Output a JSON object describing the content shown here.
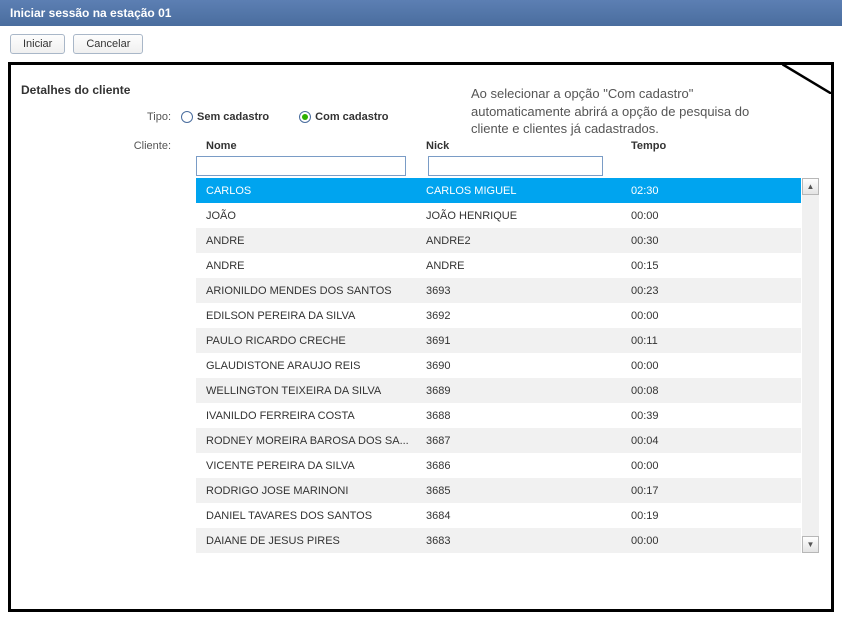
{
  "window": {
    "title": "Iniciar sessão na estação 01"
  },
  "toolbar": {
    "iniciar": "Iniciar",
    "cancelar": "Cancelar"
  },
  "section": {
    "title": "Detalhes do cliente"
  },
  "annotation": "Ao selecionar a opção \"Com cadastro\" automaticamente abrirá a opção de pesquisa do cliente e clientes já cadastrados.",
  "form": {
    "tipo_label": "Tipo:",
    "cliente_label": "Cliente:",
    "radio_sem": "Sem cadastro",
    "radio_com": "Com cadastro"
  },
  "table": {
    "headers": {
      "nome": "Nome",
      "nick": "Nick",
      "tempo": "Tempo"
    },
    "filter": {
      "nome_value": "",
      "nick_value": ""
    },
    "rows": [
      {
        "nome": "CARLOS",
        "nick": "CARLOS MIGUEL",
        "tempo": "02:30",
        "selected": true
      },
      {
        "nome": "JOÃO",
        "nick": "JOÃO HENRIQUE",
        "tempo": "00:00"
      },
      {
        "nome": "ANDRE",
        "nick": "ANDRE2",
        "tempo": "00:30"
      },
      {
        "nome": "ANDRE",
        "nick": "ANDRE",
        "tempo": "00:15"
      },
      {
        "nome": "ARIONILDO MENDES DOS SANTOS",
        "nick": "3693",
        "tempo": "00:23"
      },
      {
        "nome": "EDILSON PEREIRA DA SILVA",
        "nick": "3692",
        "tempo": "00:00"
      },
      {
        "nome": "PAULO RICARDO CRECHE",
        "nick": "3691",
        "tempo": "00:11"
      },
      {
        "nome": "GLAUDISTONE ARAUJO REIS",
        "nick": "3690",
        "tempo": "00:00"
      },
      {
        "nome": "WELLINGTON TEIXEIRA DA SILVA",
        "nick": "3689",
        "tempo": "00:08"
      },
      {
        "nome": "IVANILDO FERREIRA COSTA",
        "nick": "3688",
        "tempo": "00:39"
      },
      {
        "nome": "RODNEY MOREIRA BAROSA DOS SA...",
        "nick": "3687",
        "tempo": "00:04"
      },
      {
        "nome": "VICENTE PEREIRA DA SILVA",
        "nick": "3686",
        "tempo": "00:00"
      },
      {
        "nome": "RODRIGO JOSE MARINONI",
        "nick": "3685",
        "tempo": "00:17"
      },
      {
        "nome": "DANIEL TAVARES DOS  SANTOS",
        "nick": "3684",
        "tempo": "00:19"
      },
      {
        "nome": "DAIANE DE JESUS PIRES",
        "nick": "3683",
        "tempo": "00:00"
      }
    ]
  }
}
